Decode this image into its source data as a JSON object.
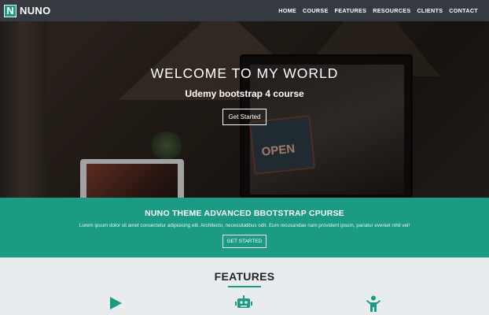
{
  "nav": {
    "logo_letter": "N",
    "brand": "NUNO",
    "links": [
      "HOME",
      "COURSE",
      "FEATURES",
      "RESOURCES",
      "CLIENTS",
      "CONTACT"
    ]
  },
  "hero": {
    "title": "WELCOME TO MY WORLD",
    "subtitle": "Udemy bootstrap 4 course",
    "button": "Get Started",
    "sign_text": "OPEN"
  },
  "promo": {
    "title": "NUNO THEME ADVANCED BBOTSTRAP CPURSE",
    "text": "Lorem ipsum dolor sit amet consectetur adipisicing elit. Architecto, necessitatibus odit. Eum recusandae nam provident ipsum, pariatur eveniet nihil vel!",
    "button": "GET STARTED"
  },
  "features": {
    "title": "FEATURES",
    "icons": [
      "play-icon",
      "robot-icon",
      "child-icon"
    ]
  },
  "colors": {
    "navbar": "#343a40",
    "accent": "#1b9b84",
    "section_bg": "#e9ecef"
  }
}
